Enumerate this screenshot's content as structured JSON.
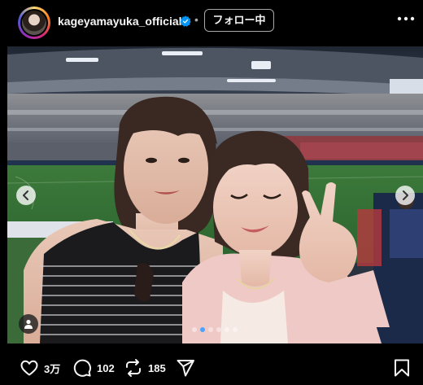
{
  "header": {
    "username": "kageyamayuka_official",
    "verified": true,
    "separator": "•",
    "follow_label": "フォロー中",
    "more_icon": "more-horizontal-icon"
  },
  "post": {
    "image_description_icon": "photo",
    "carousel_count": 6,
    "carousel_active_index": 1
  },
  "actions": {
    "likes": "3万",
    "comments": "102",
    "reposts": "185",
    "like_icon": "heart-icon",
    "comment_icon": "comment-icon",
    "repost_icon": "repost-icon",
    "share_icon": "send-icon",
    "save_icon": "bookmark-icon"
  },
  "colors": {
    "background": "#000000",
    "text": "#f5f5f5",
    "verified": "#0095f6",
    "active_dot": "#4aa3ff"
  }
}
